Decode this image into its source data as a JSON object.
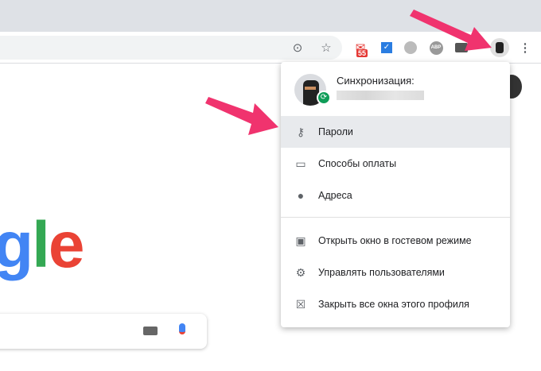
{
  "toolbar": {
    "icons": [
      "location-icon",
      "star-icon",
      "gmail-icon",
      "todo-icon",
      "globe-icon",
      "abp-icon",
      "extension-icon",
      "profile-avatar",
      "more-icon"
    ],
    "gmail_badge": "55",
    "abp_label": "ABP"
  },
  "logo": {
    "letters": [
      "g",
      "l",
      "e"
    ],
    "colors": [
      "#4285f4",
      "#34a853",
      "#ea4335"
    ]
  },
  "menu": {
    "sync_title": "Синхронизация:",
    "items": [
      {
        "label": "Пароли",
        "icon": "key-icon",
        "selected": true
      },
      {
        "label": "Способы оплаты",
        "icon": "credit-card-icon"
      },
      {
        "label": "Адреса",
        "icon": "location-pin-icon"
      },
      {
        "label": "Открыть окно в гостевом режиме",
        "icon": "guest-badge-icon"
      },
      {
        "label": "Управлять пользователями",
        "icon": "gear-icon"
      },
      {
        "label": "Закрыть все окна этого профиля",
        "icon": "close-windows-icon"
      }
    ]
  },
  "annotation_color": "#f0336e"
}
